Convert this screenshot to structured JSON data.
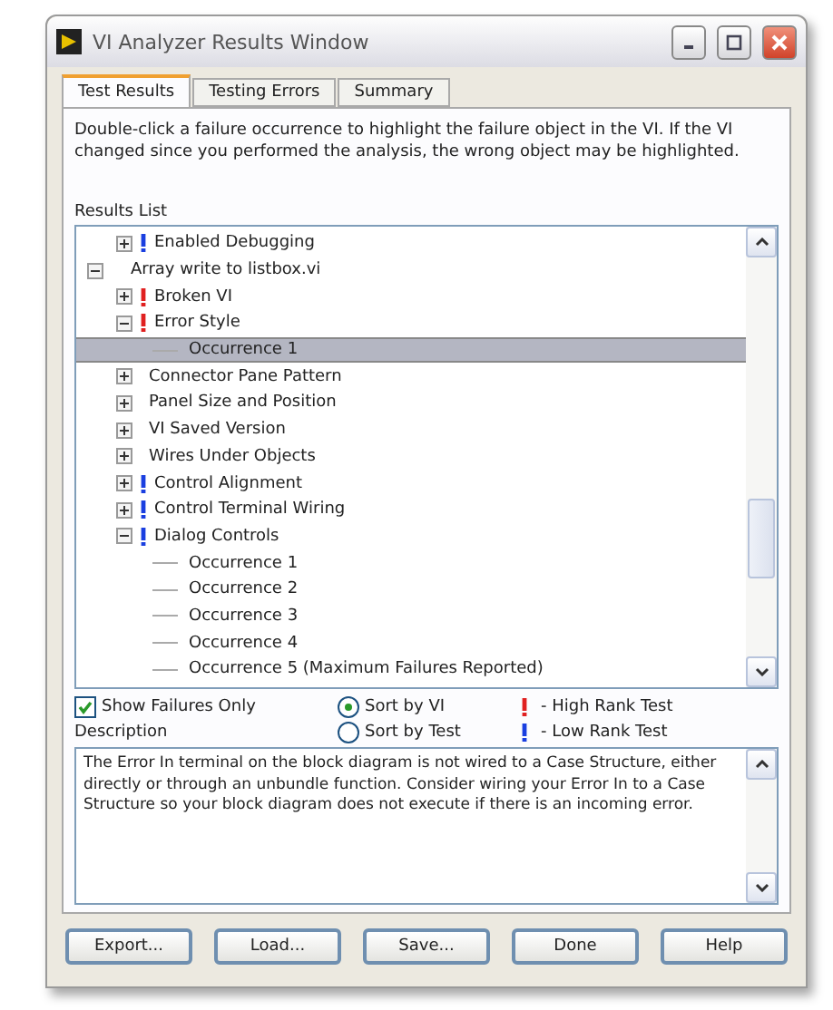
{
  "window": {
    "title": "VI Analyzer Results Window"
  },
  "tabs": [
    {
      "label": "Test Results",
      "selected": true
    },
    {
      "label": "Testing Errors",
      "selected": false
    },
    {
      "label": "Summary",
      "selected": false
    }
  ],
  "instructions": "Double-click a failure occurrence to highlight the failure object in the VI.  If the VI changed since you performed the analysis, the wrong object may be highlighted.",
  "results_label": "Results List",
  "tree": [
    {
      "children": [
        {
          "kind": "test",
          "label": "Enabled Debugging",
          "color": "#1a3fe0",
          "expanded": false,
          "selected": false
        }
      ]
    },
    {
      "kind": "vi",
      "label": "Array write to listbox.vi",
      "expanded": true,
      "selected": false,
      "children": [
        {
          "kind": "test",
          "label": "Broken VI",
          "color": "#e02020",
          "expanded": false,
          "selected": false
        },
        {
          "kind": "test",
          "label": "Error Style",
          "color": "#e02020",
          "expanded": true,
          "selected": false,
          "children": [
            {
              "kind": "occurrence",
              "label": "Occurrence 1",
              "selected": true
            }
          ]
        },
        {
          "kind": "test",
          "label": "Connector Pane Pattern",
          "expanded": false,
          "selected": false
        },
        {
          "kind": "test",
          "label": "Panel Size and Position",
          "expanded": false,
          "selected": false
        },
        {
          "kind": "test",
          "label": "VI Saved Version",
          "expanded": false,
          "selected": false
        },
        {
          "kind": "test",
          "label": "Wires Under Objects",
          "expanded": false,
          "selected": false
        },
        {
          "kind": "test",
          "label": "Control Alignment",
          "color": "#1a3fe0",
          "expanded": false,
          "selected": false
        },
        {
          "kind": "test",
          "label": "Control Terminal Wiring",
          "color": "#1a3fe0",
          "expanded": false,
          "selected": false
        },
        {
          "kind": "test",
          "label": "Dialog Controls",
          "color": "#1a3fe0",
          "expanded": true,
          "selected": false,
          "children": [
            {
              "kind": "occurrence",
              "label": "Occurrence 1",
              "selected": false
            },
            {
              "kind": "occurrence",
              "label": "Occurrence 2",
              "selected": false
            },
            {
              "kind": "occurrence",
              "label": "Occurrence 3",
              "selected": false
            },
            {
              "kind": "occurrence",
              "label": "Occurrence 4",
              "selected": false
            },
            {
              "kind": "occurrence",
              "label": "Occurrence 5 (Maximum Failures Reported)",
              "selected": false
            }
          ]
        }
      ]
    }
  ],
  "show_failures_only": {
    "label": "Show Failures Only",
    "checked": true
  },
  "sort": [
    {
      "label": "Sort by VI",
      "selected": true
    },
    {
      "label": "Sort by Test",
      "selected": false
    }
  ],
  "legend": [
    {
      "color": "#e02020",
      "label": "- High Rank Test"
    },
    {
      "color": "#1a3fe0",
      "label": "- Low Rank Test"
    }
  ],
  "description_label": "Description",
  "description": "The Error In terminal on the block diagram is not wired to a Case Structure, either directly or through an unbundle function.  Consider wiring your Error In to a Case Structure so your block diagram does not execute if there is an incoming error.",
  "buttons": [
    "Export...",
    "Load...",
    "Save...",
    "Done",
    "Help"
  ]
}
